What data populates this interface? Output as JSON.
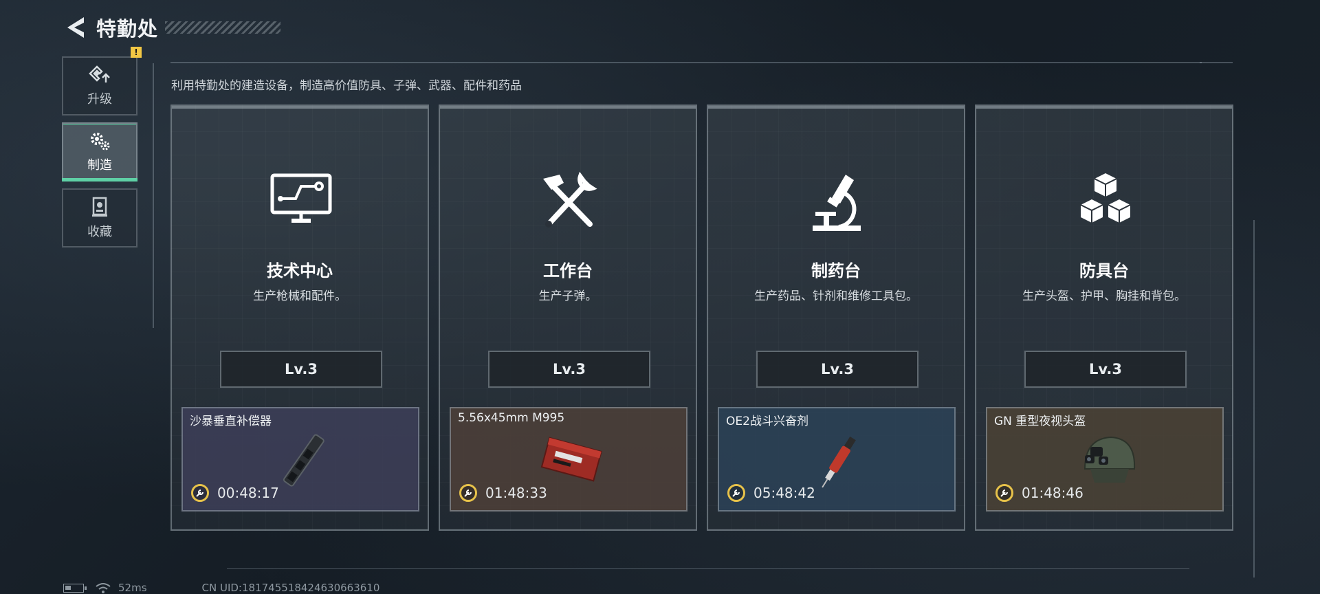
{
  "header": {
    "title": "特勤处"
  },
  "sidebar": {
    "items": [
      {
        "label": "升级",
        "badge": "!"
      },
      {
        "label": "制造",
        "active": true
      },
      {
        "label": "收藏"
      }
    ]
  },
  "description": "利用特勤处的建造设备，制造高价值防具、子弹、武器、配件和药品",
  "cards": [
    {
      "name": "技术中心",
      "subtitle": "生产枪械和配件。",
      "level": "Lv.3",
      "icon": "monitor-circuit-icon",
      "craft": {
        "item": "沙暴垂直补偿器",
        "timer": "00:48:17",
        "bg": "#3d3e58"
      }
    },
    {
      "name": "工作台",
      "subtitle": "生产子弹。",
      "level": "Lv.3",
      "icon": "hammer-wrench-icon",
      "craft": {
        "item": "5.56x45mm M995",
        "timer": "01:48:33",
        "bg": "#4d3f38"
      }
    },
    {
      "name": "制药台",
      "subtitle": "生产药品、针剂和维修工具包。",
      "level": "Lv.3",
      "icon": "microscope-icon",
      "craft": {
        "item": "OE2战斗兴奋剂",
        "timer": "05:48:42",
        "bg": "#2c4257"
      }
    },
    {
      "name": "防具台",
      "subtitle": "生产头盔、护甲、胸挂和背包。",
      "level": "Lv.3",
      "icon": "cubes-icon",
      "craft": {
        "item": "GN 重型夜视头盔",
        "timer": "01:48:46",
        "bg": "#4b4235"
      }
    }
  ],
  "status": {
    "ping": "52ms",
    "uid": "CN UID:181745518424630663610"
  },
  "colors": {
    "accent": "#5fd1a6",
    "badge": "#f2c744",
    "timer": "#e7c24a"
  }
}
